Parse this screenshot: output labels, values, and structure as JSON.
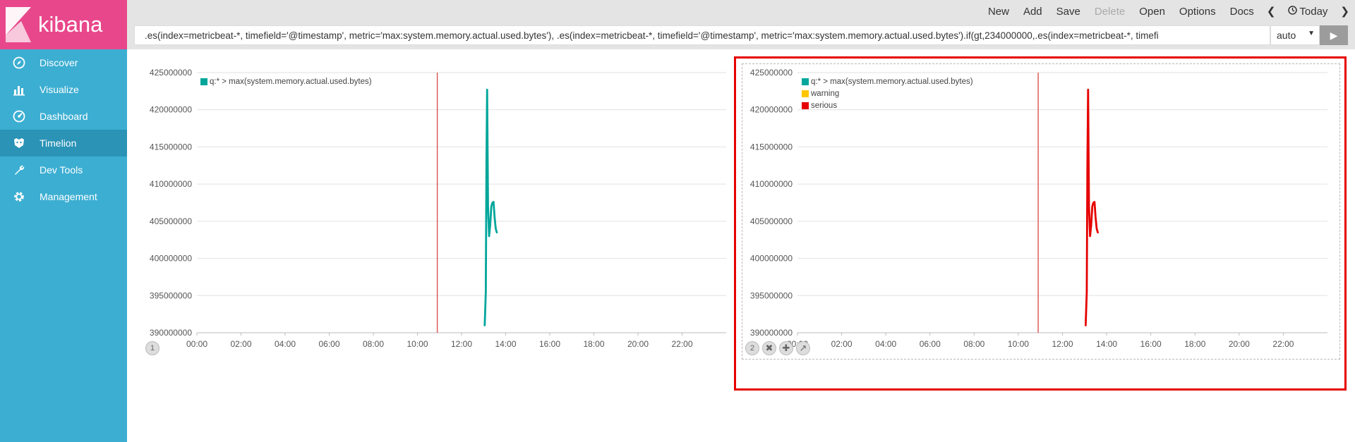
{
  "app": {
    "logo_text": "kibana",
    "accent_color": "#e8488b",
    "sidebar_color": "#3caed2"
  },
  "sidebar": {
    "items": [
      {
        "label": "Discover",
        "icon": "compass-icon"
      },
      {
        "label": "Visualize",
        "icon": "bar-chart-icon"
      },
      {
        "label": "Dashboard",
        "icon": "dashboard-icon"
      },
      {
        "label": "Timelion",
        "icon": "timelion-icon",
        "active": true
      },
      {
        "label": "Dev Tools",
        "icon": "wrench-icon"
      },
      {
        "label": "Management",
        "icon": "gear-icon"
      }
    ]
  },
  "toolbar": {
    "new_label": "New",
    "add_label": "Add",
    "save_label": "Save",
    "delete_label": "Delete",
    "open_label": "Open",
    "options_label": "Options",
    "docs_label": "Docs",
    "time_label": "Today"
  },
  "query": {
    "expression": ".es(index=metricbeat-*, timefield='@timestamp', metric='max:system.memory.actual.used.bytes'), .es(index=metricbeat-*, timefield='@timestamp', metric='max:system.memory.actual.used.bytes').if(gt,234000000,.es(index=metricbeat-*, timefi",
    "interval": "auto"
  },
  "chart_data": [
    {
      "type": "line",
      "panel_number": "1",
      "title": "",
      "xlabel": "",
      "ylabel": "",
      "x_ticks": [
        "00:00",
        "02:00",
        "04:00",
        "06:00",
        "08:00",
        "10:00",
        "12:00",
        "14:00",
        "16:00",
        "18:00",
        "20:00",
        "22:00"
      ],
      "y_ticks": [
        "425000000",
        "420000000",
        "415000000",
        "410000000",
        "405000000",
        "400000000",
        "395000000",
        "390000000"
      ],
      "ylim": [
        390000000,
        425000000
      ],
      "xlim_hours": [
        0,
        24
      ],
      "now_marker_hour": 10.9,
      "grid": true,
      "legend_position": "top-left",
      "series": [
        {
          "name": "q:* > max(system.memory.actual.used.bytes)",
          "color": "#00a69b",
          "x_hours": [
            13.05,
            13.1,
            13.13,
            13.16,
            13.2,
            13.25,
            13.3,
            13.35,
            13.4,
            13.45,
            13.5,
            13.55,
            13.6
          ],
          "values": [
            391000000,
            395500000,
            413000000,
            422700000,
            407000000,
            403000000,
            404500000,
            407000000,
            407500000,
            407600000,
            405500000,
            404000000,
            403500000
          ]
        }
      ]
    },
    {
      "type": "line",
      "panel_number": "2",
      "title": "",
      "xlabel": "",
      "ylabel": "",
      "x_ticks": [
        "00:00",
        "02:00",
        "04:00",
        "06:00",
        "08:00",
        "10:00",
        "12:00",
        "14:00",
        "16:00",
        "18:00",
        "20:00",
        "22:00"
      ],
      "y_ticks": [
        "425000000",
        "420000000",
        "415000000",
        "410000000",
        "405000000",
        "400000000",
        "395000000",
        "390000000"
      ],
      "ylim": [
        390000000,
        425000000
      ],
      "xlim_hours": [
        0,
        24
      ],
      "now_marker_hour": 10.9,
      "grid": true,
      "legend_position": "top-left",
      "series": [
        {
          "name": "q:* > max(system.memory.actual.used.bytes)",
          "color": "#00a69b",
          "x_hours": [],
          "values": []
        },
        {
          "name": "warning",
          "color": "#ffc600",
          "x_hours": [],
          "values": []
        },
        {
          "name": "serious",
          "color": "#e60000",
          "x_hours": [
            13.05,
            13.1,
            13.13,
            13.16,
            13.2,
            13.25,
            13.3,
            13.35,
            13.4,
            13.45,
            13.5,
            13.55,
            13.6
          ],
          "values": [
            391000000,
            395500000,
            413000000,
            422700000,
            407000000,
            403000000,
            404500000,
            407000000,
            407500000,
            407600000,
            405500000,
            404000000,
            403500000
          ]
        }
      ]
    }
  ]
}
